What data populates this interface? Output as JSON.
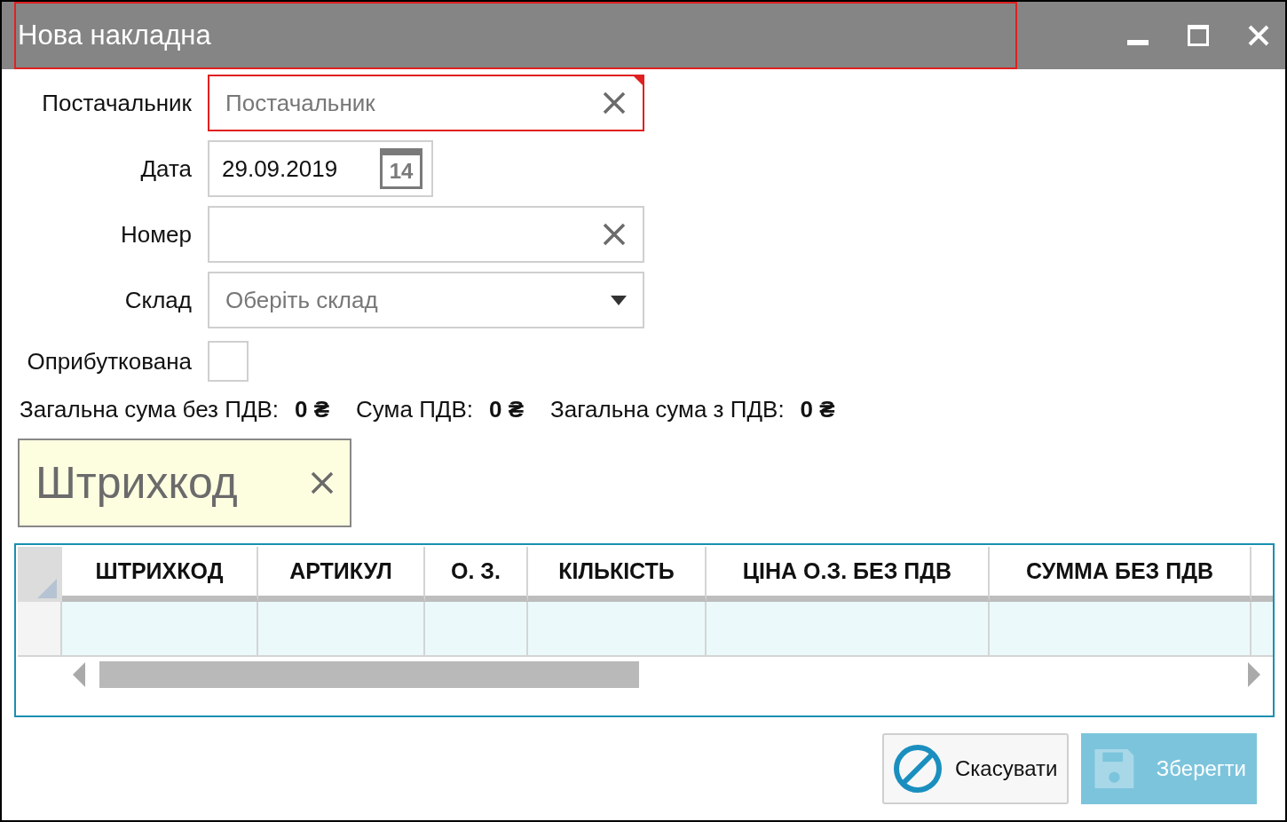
{
  "window": {
    "title": "Нова накладна"
  },
  "fields": [
    {
      "kind": "text",
      "label": "Постачальник",
      "placeholder": "Постачальник",
      "invalid": true
    },
    {
      "kind": "date",
      "label": "Дата",
      "value": "29.09.2019",
      "calendar_day": "14"
    },
    {
      "kind": "text",
      "label": "Номер",
      "invalid": false
    },
    {
      "kind": "select",
      "label": "Склад",
      "placeholder": "Оберіть склад"
    },
    {
      "kind": "checkbox",
      "label": "Оприбуткована",
      "checked": false
    }
  ],
  "totals": [
    {
      "label": "Загальна сума без ПДВ:",
      "value": "0 ₴"
    },
    {
      "label": "Сума ПДВ:",
      "value": "0 ₴"
    },
    {
      "label": "Загальна сума з ПДВ:",
      "value": "0 ₴"
    }
  ],
  "barcode_search": {
    "placeholder": "Штрихкод"
  },
  "table": {
    "columns": [
      "ШТРИХКОД",
      "АРТИКУЛ",
      "О. З.",
      "КІЛЬКІСТЬ",
      "ЦІНА О.З. БЕЗ ПДВ",
      "СУММА БЕЗ ПДВ"
    ]
  },
  "buttons": [
    {
      "kind": "cancel",
      "label": "Скасувати",
      "disabled": false
    },
    {
      "kind": "save",
      "label": "Зберегти",
      "disabled": true
    }
  ]
}
